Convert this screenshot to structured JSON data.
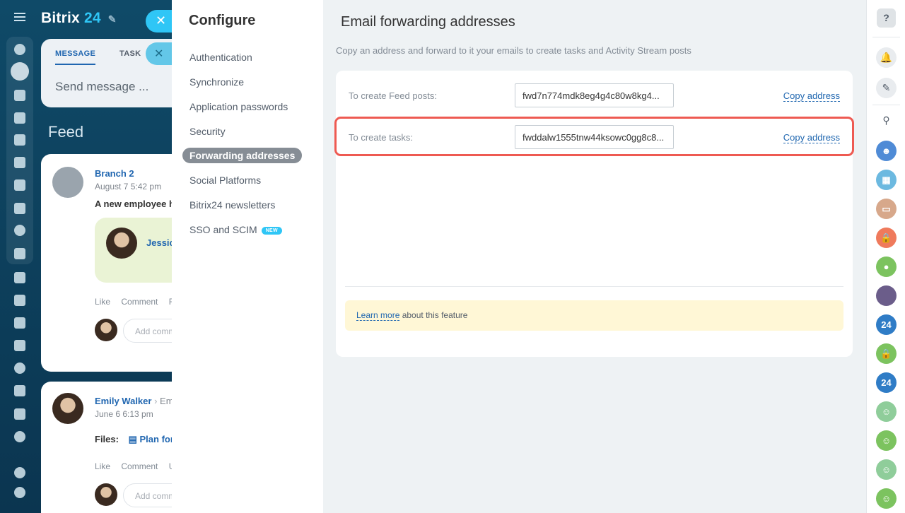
{
  "app": {
    "brand_name": "Bitrix",
    "brand_number": "24"
  },
  "composer": {
    "tabs": [
      "MESSAGE",
      "TASK"
    ],
    "placeholder": "Send message ..."
  },
  "feed": {
    "title": "Feed",
    "posts": [
      {
        "author": "Branch 2",
        "date": "August 7 5:42 pm",
        "text": "A new employee h",
        "mention": "Jessic",
        "actions": [
          "Like",
          "Comment",
          "Fo"
        ],
        "add_comment": "Add comm"
      },
      {
        "author": "Emily Walker",
        "author_suffix": "Em",
        "date": "June 6 6:13 pm",
        "files_label": "Files:",
        "file_name": "Plan for",
        "actions": [
          "Like",
          "Comment",
          "Ur"
        ],
        "add_comment": "Add comm"
      }
    ]
  },
  "configure": {
    "title": "Configure",
    "nav_items": [
      {
        "label": "Authentication"
      },
      {
        "label": "Synchronize"
      },
      {
        "label": "Application passwords"
      },
      {
        "label": "Security"
      },
      {
        "label": "Forwarding addresses"
      },
      {
        "label": "Social Platforms"
      },
      {
        "label": "Bitrix24 newsletters"
      },
      {
        "label": "SSO and SCIM",
        "badge": "NEW"
      }
    ],
    "active_item": "Forwarding addresses"
  },
  "forwarding": {
    "title": "Email forwarding addresses",
    "description": "Copy an address and forward to it your emails to create tasks and Activity Stream posts",
    "rows": [
      {
        "label": "To create Feed posts:",
        "address": "fwd7n774mdk8eg4g4c80w8kg4...",
        "copy_label": "Copy address"
      },
      {
        "label": "To create tasks:",
        "address": "fwddalw1555tnw44ksowc0gg8c8...",
        "copy_label": "Copy address"
      }
    ],
    "note_link": "Learn more",
    "note_text": " about this feature"
  },
  "right_rail": {
    "help_label": "?",
    "badge_24": "24"
  },
  "colors": {
    "accent": "#2fc6f6",
    "link": "#2067b0",
    "highlight_border": "#ee5a52",
    "nav_active_bg": "#868d95",
    "note_bg": "#fff7d6"
  },
  "icons": {
    "close": "close-icon",
    "help": "help-icon",
    "bell": "bell-icon",
    "search": "search-icon"
  }
}
